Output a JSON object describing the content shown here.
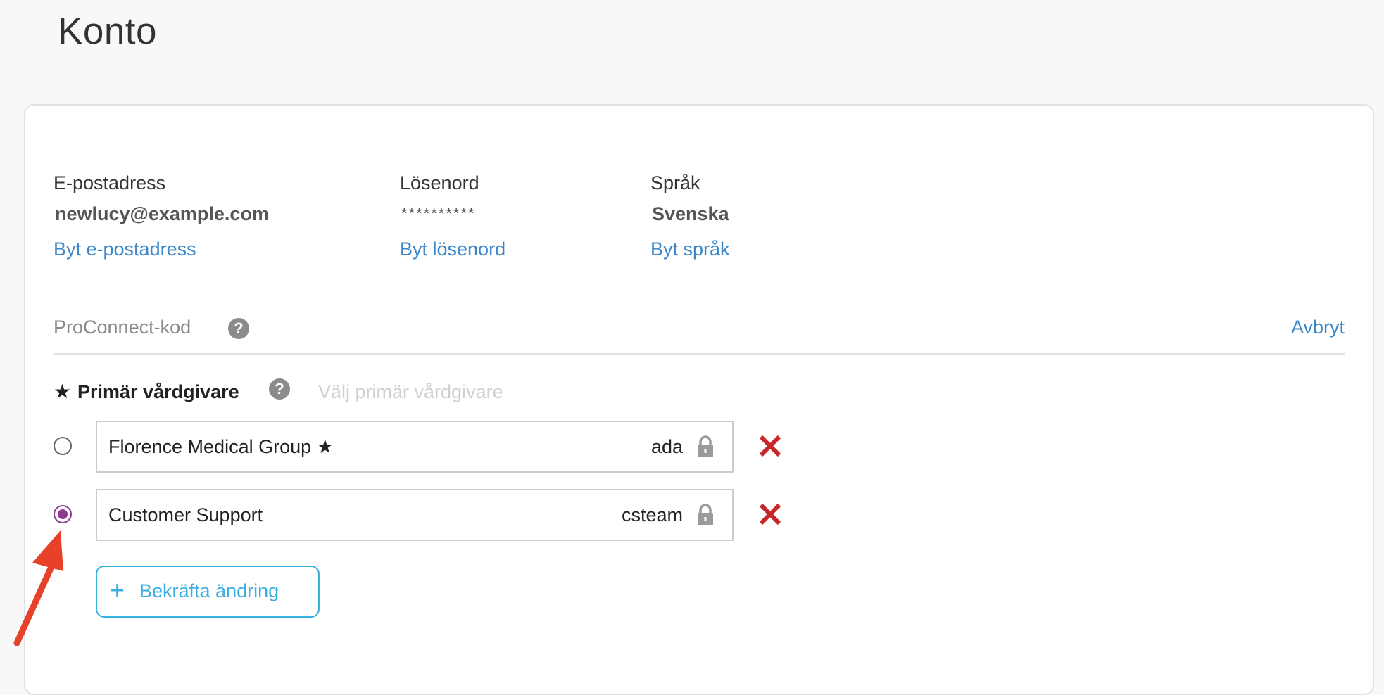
{
  "page": {
    "title": "Konto"
  },
  "account": {
    "email": {
      "label": "E-postadress",
      "value": "newlucy@example.com",
      "link": "Byt e-postadress"
    },
    "password": {
      "label": "Lösenord",
      "value": "**********",
      "link": "Byt lösenord"
    },
    "language": {
      "label": "Språk",
      "value": "Svenska",
      "link": "Byt språk"
    }
  },
  "proconnect": {
    "label": "ProConnect-kod",
    "help_icon": "?",
    "cancel_label": "Avbryt"
  },
  "primary": {
    "star": "★",
    "label": "Primär vårdgivare",
    "help_icon": "?",
    "placeholder": "Välj primär vårdgivare"
  },
  "providers": [
    {
      "name": "Florence Medical Group ★",
      "user": "ada",
      "selected": false,
      "icon": "lock-icon"
    },
    {
      "name": "Customer Support",
      "user": "csteam",
      "selected": true,
      "icon": "lock-icon"
    }
  ],
  "confirm_button": {
    "icon": "+",
    "label": "Bekräfta ändring"
  },
  "colors": {
    "link": "#3a86c8",
    "radio_selected": "#8e3a90",
    "remove": "#c62828",
    "confirm": "#3ab0e0",
    "annotation_arrow": "#e8412a"
  }
}
